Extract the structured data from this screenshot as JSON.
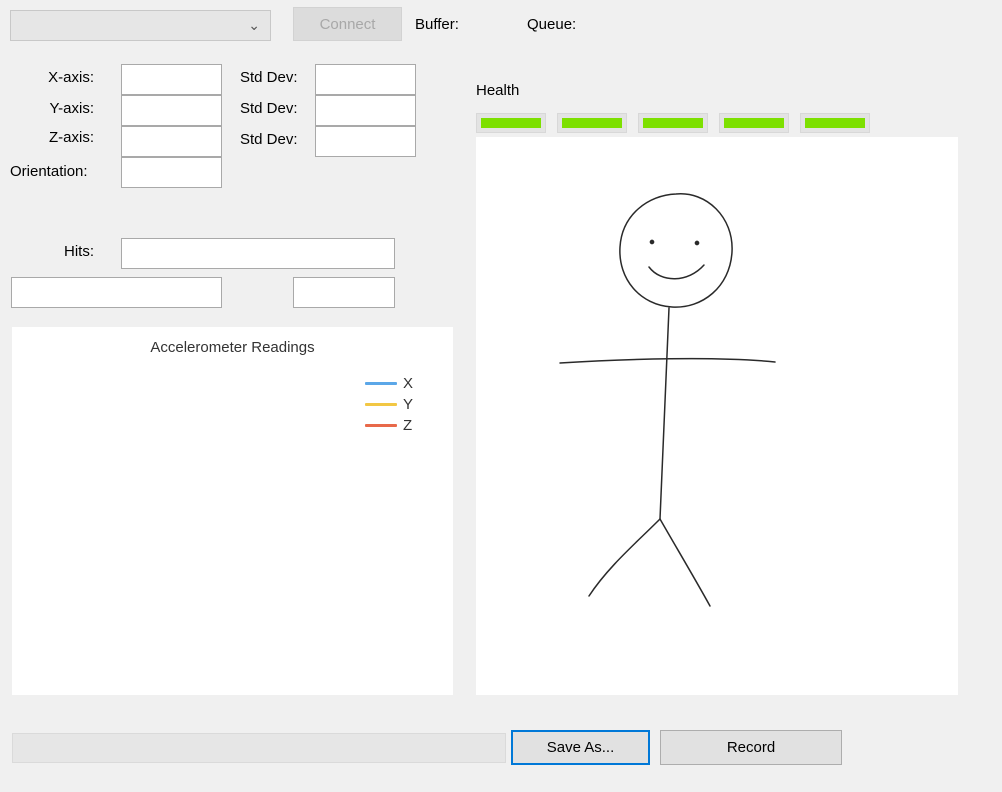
{
  "toolbar": {
    "port_combo_value": "",
    "connect_label": "Connect",
    "buffer_label": "Buffer:",
    "queue_label": "Queue:"
  },
  "axes": {
    "x_label": "X-axis:",
    "y_label": "Y-axis:",
    "z_label": "Z-axis:",
    "orientation_label": "Orientation:",
    "std_dev_label": "Std Dev:",
    "x_value": "",
    "y_value": "",
    "z_value": "",
    "orientation_value": "",
    "x_std": "",
    "y_std": "",
    "z_std": ""
  },
  "hits": {
    "label": "Hits:",
    "value": "",
    "extra_left_value": "",
    "extra_right_value": ""
  },
  "health": {
    "label": "Health",
    "bars": [
      1,
      1,
      1,
      1,
      1
    ],
    "bar_color": "#7de000"
  },
  "chart": {
    "title": "Accelerometer Readings",
    "series": [
      {
        "name": "X",
        "color": "#5ba7e8"
      },
      {
        "name": "Y",
        "color": "#f2c744"
      },
      {
        "name": "Z",
        "color": "#e8694a"
      }
    ]
  },
  "actions": {
    "save_as_label": "Save As...",
    "record_label": "Record",
    "progress": 0
  },
  "canvas": {
    "drawing": "stick-figure"
  }
}
